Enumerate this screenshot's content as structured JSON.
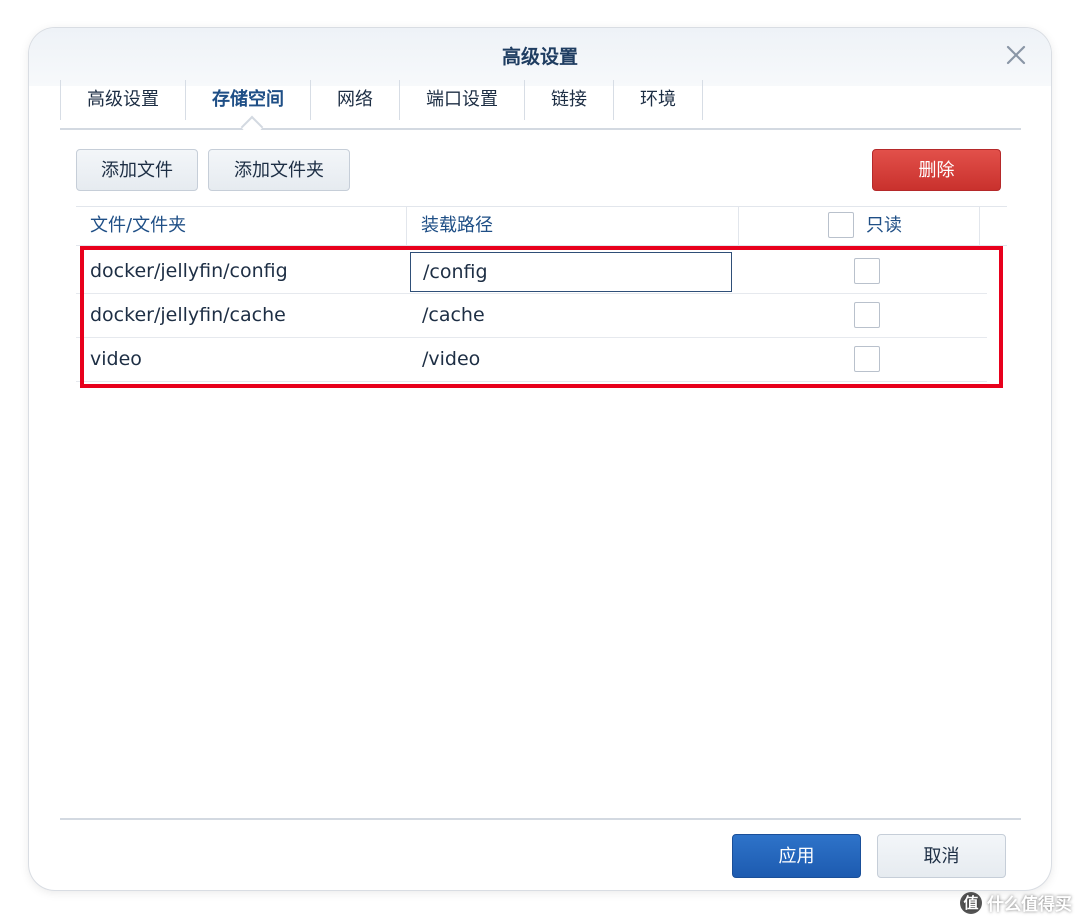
{
  "dialog": {
    "title": "高级设置",
    "close_icon": "close-icon"
  },
  "tabs": [
    {
      "label": "高级设置",
      "active": false
    },
    {
      "label": "存储空间",
      "active": true
    },
    {
      "label": "网络",
      "active": false
    },
    {
      "label": "端口设置",
      "active": false
    },
    {
      "label": "链接",
      "active": false
    },
    {
      "label": "环境",
      "active": false
    }
  ],
  "toolbar": {
    "add_file_label": "添加文件",
    "add_folder_label": "添加文件夹",
    "delete_label": "删除"
  },
  "table": {
    "columns": {
      "file_folder": "文件/文件夹",
      "mount_path": "装载路径",
      "read_only": "只读"
    },
    "header_readonly_checked": false,
    "rows": [
      {
        "file": "docker/jellyfin/config",
        "mount": "/config",
        "read_only": false,
        "editing": true
      },
      {
        "file": "docker/jellyfin/cache",
        "mount": "/cache",
        "read_only": false,
        "editing": false
      },
      {
        "file": "video",
        "mount": "/video",
        "read_only": false,
        "editing": false
      }
    ]
  },
  "footer": {
    "apply_label": "应用",
    "cancel_label": "取消"
  },
  "watermark": {
    "icon": "值",
    "text": "什么值得买"
  },
  "colors": {
    "accent_blue": "#1f4f86",
    "delete_red": "#d9413c",
    "apply_blue": "#2566bd",
    "highlight_red": "#e8001c"
  }
}
